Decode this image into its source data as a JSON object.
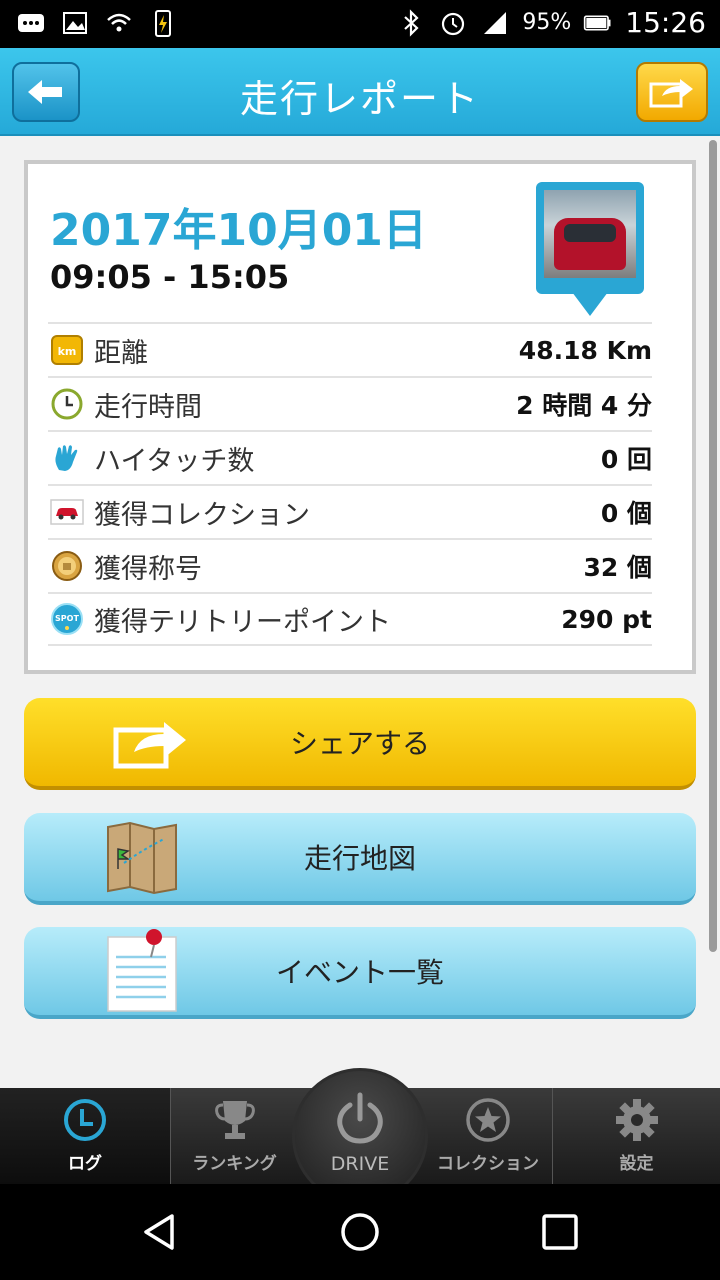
{
  "status_bar": {
    "battery_percent": "95%",
    "time": "15:26"
  },
  "header": {
    "title": "走行レポート"
  },
  "report": {
    "date": "2017年10月01日",
    "time_range": "09:05 - 15:05",
    "stats": [
      {
        "icon": "km-icon",
        "label": "距離",
        "value": "48.18 Km"
      },
      {
        "icon": "clock-icon",
        "label": "走行時間",
        "value": "2 時間 4 分"
      },
      {
        "icon": "hi-five-icon",
        "label": "ハイタッチ数",
        "value": "0 回"
      },
      {
        "icon": "car-collection-icon",
        "label": "獲得コレクション",
        "value": "0 個"
      },
      {
        "icon": "title-medal-icon",
        "label": "獲得称号",
        "value": "32 個"
      },
      {
        "icon": "spot-icon",
        "label": "獲得テリトリーポイント",
        "value": "290 pt"
      }
    ]
  },
  "actions": {
    "share_label": "シェアする",
    "map_label": "走行地図",
    "events_label": "イベント一覧"
  },
  "tabs": {
    "log": "ログ",
    "ranking": "ランキング",
    "drive": "DRIVE",
    "collection": "コレクション",
    "settings": "設定"
  },
  "colors": {
    "header": "#2bb3df",
    "date": "#2aa6d4",
    "share_button": "#f5c400",
    "secondary_button": "#8fd6ee"
  }
}
